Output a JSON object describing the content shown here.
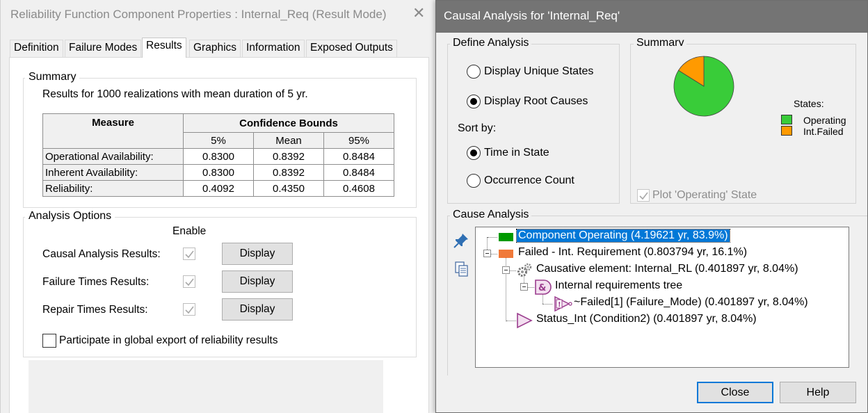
{
  "left_window": {
    "title": "Reliability Function Component Properties : Internal_Req (Result Mode)",
    "close_glyph": "✕",
    "tabs": [
      {
        "label": "Definition"
      },
      {
        "label": "Failure Modes"
      },
      {
        "label": "Results"
      },
      {
        "label": "Graphics"
      },
      {
        "label": "Information"
      },
      {
        "label": "Exposed Outputs"
      }
    ],
    "active_tab": "Results",
    "summary": {
      "label": "Summary",
      "description": "Results for 1000 realizations with mean duration of 5 yr.",
      "table": {
        "measure_header": "Measure",
        "bounds_header": "Confidence Bounds",
        "percentiles": [
          "5%",
          "Mean",
          "95%"
        ],
        "rows": [
          {
            "measure": "Operational Availability:",
            "values": [
              "0.8300",
              "0.8392",
              "0.8484"
            ]
          },
          {
            "measure": "Inherent Availability:",
            "values": [
              "0.8300",
              "0.8392",
              "0.8484"
            ]
          },
          {
            "measure": "Reliability:",
            "values": [
              "0.4092",
              "0.4350",
              "0.4608"
            ]
          }
        ]
      }
    },
    "analysis_options": {
      "label": "Analysis Options",
      "enable_header": "Enable",
      "rows": [
        {
          "label": "Causal Analysis Results:",
          "button": "Display",
          "checked": true
        },
        {
          "label": "Failure Times Results:",
          "button": "Display",
          "checked": true
        },
        {
          "label": "Repair Times Results:",
          "button": "Display",
          "checked": true
        }
      ],
      "export_label": "Participate in global export of reliability results",
      "export_checked": false
    }
  },
  "right_window": {
    "title": "Causal Analysis for 'Internal_Req'",
    "define_analysis": {
      "label": "Define Analysis",
      "display_unique_states": "Display Unique States",
      "display_root_causes": "Display Root Causes",
      "sort_by": "Sort by:",
      "time_in_state": "Time in State",
      "occurrence_count": "Occurrence Count",
      "selected_display": "Display Root Causes",
      "selected_sort": "Time in State"
    },
    "summary": {
      "label": "Summary",
      "states_label": "States:",
      "pie": [
        {
          "name": "Operating",
          "share": 83.9,
          "color": "#39cc39"
        },
        {
          "name": "Int.Failed",
          "share": 16.1,
          "color": "#ff9a00"
        }
      ],
      "plot_operating_label": "Plot 'Operating' State",
      "plot_operating_checked": true
    },
    "cause_analysis": {
      "label": "Cause Analysis",
      "nodes": [
        {
          "text": "Component Operating (4.19621 yr, 83.9%)",
          "color": "#009a00",
          "selected": true
        },
        {
          "text": "Failed - Int. Requirement (0.803794 yr, 16.1%)",
          "color": "#f07a3a"
        },
        {
          "text": "Causative element: Internal_RL (0.401897 yr, 8.04%)"
        },
        {
          "text": "Internal requirements tree"
        },
        {
          "text": "~Failed[1]  (Failure_Mode) (0.401897 yr, 8.04%)"
        },
        {
          "text": "Status_Int  (Condition2) (0.401897 yr, 8.04%)"
        }
      ]
    },
    "buttons": {
      "close": "Close",
      "help": "Help"
    }
  }
}
